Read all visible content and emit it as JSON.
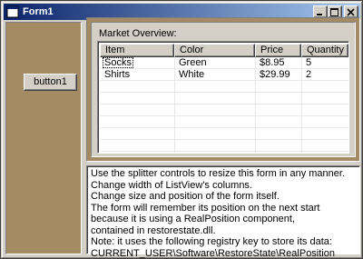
{
  "window": {
    "title": "Form1"
  },
  "left_panel": {
    "button_label": "button1"
  },
  "market": {
    "label": "Market Overview:",
    "columns": [
      "Item",
      "Color",
      "Price",
      "Quantity"
    ],
    "rows": [
      [
        "Socks",
        "Green",
        "$8.95",
        "5"
      ],
      [
        "Shirts",
        "White",
        "$29.99",
        "2"
      ]
    ]
  },
  "notes": [
    "Use the splitter controls to resize this form in any manner.",
    "Change width of ListView's columns.",
    "Change size and position of the form itself.",
    "The form will remember its position on the next start",
    "because it is using a RealPosition component,",
    "contained in restorestate.dll.",
    "Note: it uses the following registry key to store its data:",
    "CURRENT_USER\\Software\\RestoreState\\RealPosition"
  ],
  "colors": {
    "panel_brown": "#a48b64",
    "title_start": "#0a246a",
    "title_end": "#a6caf0"
  }
}
